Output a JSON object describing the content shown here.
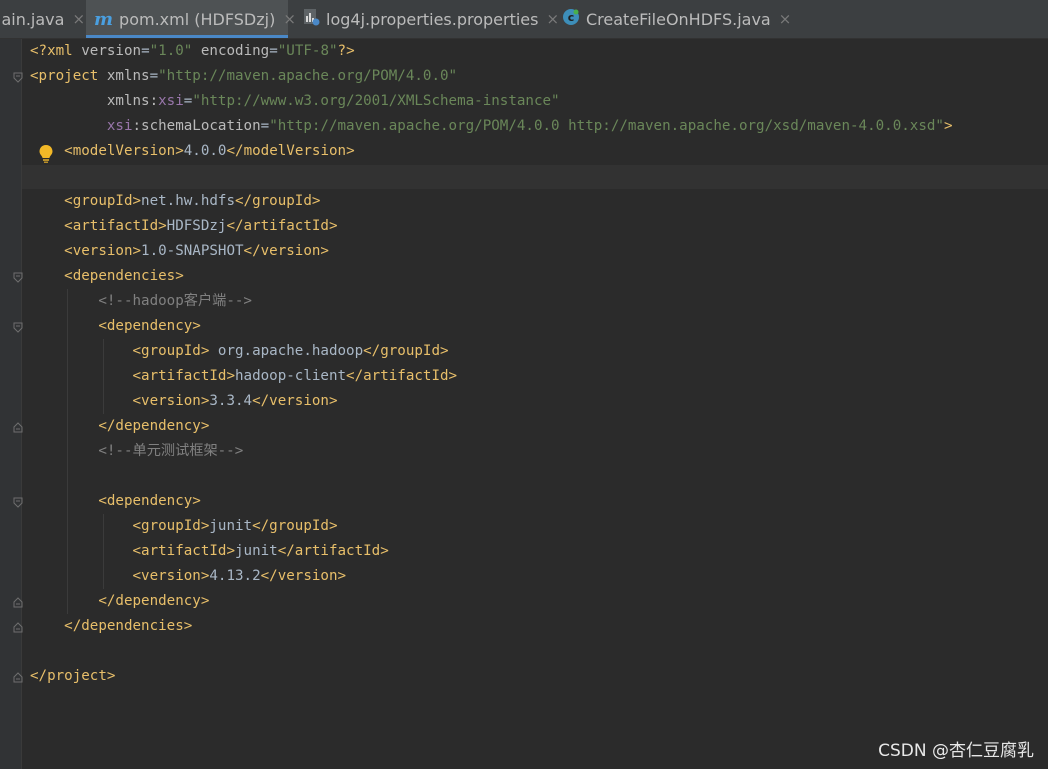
{
  "tabs": [
    {
      "label": "Main.java",
      "visible_label": "lain.java",
      "icon": "java-class-icon"
    },
    {
      "label": "pom.xml (HDFSDzj)",
      "icon": "maven-icon",
      "active": true
    },
    {
      "label": "log4j.properties.properties",
      "icon": "properties-file-icon"
    },
    {
      "label": "CreateFileOnHDFS.java",
      "icon": "java-class-icon"
    }
  ],
  "close_glyph": "×",
  "code": {
    "l1": {
      "open": "<?",
      "tag": "xml",
      "a1": " version",
      "eq1": "=",
      "v1": "\"1.0\"",
      "a2": " encoding",
      "eq2": "=",
      "v2": "\"UTF-8\"",
      "close": "?>"
    },
    "l2": {
      "open": "<",
      "tag": "project",
      "a1": " xmlns",
      "eq1": "=",
      "v1": "\"http://maven.apache.org/POM/4.0.0\""
    },
    "l3": {
      "indent": "         ",
      "a1": "xmlns",
      "colon": ":",
      "ns": "xsi",
      "eq1": "=",
      "v1": "\"http://www.w3.org/2001/XMLSchema-instance\""
    },
    "l4": {
      "indent": "         ",
      "ns": "xsi",
      "colon": ":",
      "a1": "schemaLocation",
      "eq1": "=",
      "v1": "\"http://maven.apache.org/POM/4.0.0 http://maven.apache.org/xsd/maven-4.0.0.xsd\"",
      "close": ">"
    },
    "l5": {
      "indent": "    ",
      "t1": "<modelVersion>",
      "text": "4.0.0",
      "t2": "</modelVersion>"
    },
    "l7": {
      "indent": "    ",
      "t1": "<groupId>",
      "text": "net.hw.hdfs",
      "t2": "</groupId>"
    },
    "l8": {
      "indent": "    ",
      "t1": "<artifactId>",
      "text": "HDFSDzj",
      "t2": "</artifactId>"
    },
    "l9": {
      "indent": "    ",
      "t1": "<version>",
      "text": "1.0-SNAPSHOT",
      "t2": "</version>"
    },
    "l10": {
      "indent": "    ",
      "t1": "<dependencies>"
    },
    "l11": {
      "indent": "        ",
      "comment": "<!--hadoop客户端-->"
    },
    "l12": {
      "indent": "        ",
      "t1": "<dependency>"
    },
    "l13": {
      "indent": "            ",
      "t1": "<groupId>",
      "text": " org.apache.hadoop",
      "t2": "</groupId>"
    },
    "l14": {
      "indent": "            ",
      "t1": "<artifactId>",
      "text": "hadoop-client",
      "t2": "</artifactId>"
    },
    "l15": {
      "indent": "            ",
      "t1": "<version>",
      "text": "3.3.4",
      "t2": "</version>"
    },
    "l16": {
      "indent": "        ",
      "t1": "</dependency>"
    },
    "l17": {
      "indent": "        ",
      "comment": "<!--单元测试框架-->"
    },
    "l19": {
      "indent": "        ",
      "t1": "<dependency>"
    },
    "l20": {
      "indent": "            ",
      "t1": "<groupId>",
      "text": "junit",
      "t2": "</groupId>"
    },
    "l21": {
      "indent": "            ",
      "t1": "<artifactId>",
      "text": "junit",
      "t2": "</artifactId>"
    },
    "l22": {
      "indent": "            ",
      "t1": "<version>",
      "text": "4.13.2",
      "t2": "</version>"
    },
    "l23": {
      "indent": "        ",
      "t1": "</dependency>"
    },
    "l24": {
      "indent": "    ",
      "t1": "</dependencies>"
    },
    "l26": {
      "t1": "</project>"
    }
  },
  "watermark": "CSDN @杏仁豆腐乳",
  "colors": {
    "tag": "#e8bf6a",
    "attribute": "#bababa",
    "namespace": "#9876aa",
    "string": "#6a8759",
    "comment": "#808080",
    "text": "#a9b7c6",
    "background": "#2b2b2b",
    "accent": "#4a88c7"
  }
}
